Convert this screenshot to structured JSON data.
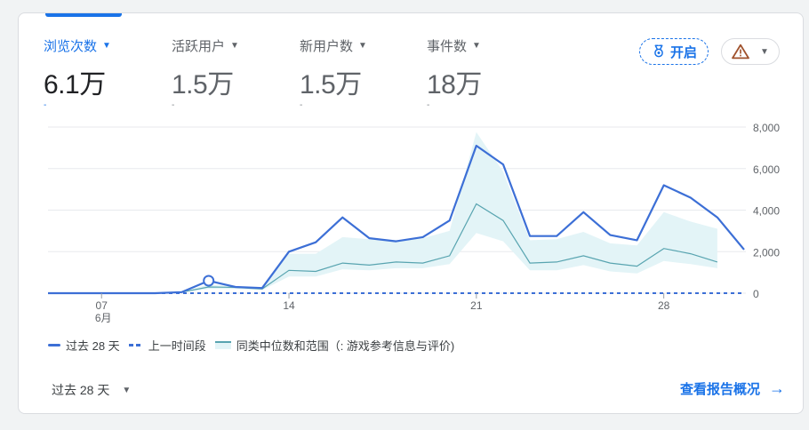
{
  "metrics": [
    {
      "label": "浏览次数",
      "value": "6.1万",
      "change": "-",
      "active": true
    },
    {
      "label": "活跃用户",
      "value": "1.5万",
      "change": "-",
      "active": false
    },
    {
      "label": "新用户数",
      "value": "1.5万",
      "change": "-",
      "active": false
    },
    {
      "label": "事件数",
      "value": "18万",
      "change": "-",
      "active": false
    }
  ],
  "buttons": {
    "open_label": "开启",
    "open_icon": "award-icon",
    "warning_icon": "warning-icon"
  },
  "legend": {
    "current": "过去 28 天",
    "previous": "上一时间段",
    "benchmark": "同类中位数和范围（: 游戏参考信息与评价)"
  },
  "footer": {
    "period_label": "过去 28 天",
    "report_link": "查看报告概况"
  },
  "colors": {
    "accent": "#1a73e8",
    "line": "#3c6fd6",
    "benchmark_line": "#58a4b0",
    "benchmark_band": "#e3f4f7"
  },
  "chart_data": {
    "type": "line",
    "x_days": [
      5,
      6,
      7,
      8,
      9,
      10,
      11,
      12,
      13,
      14,
      15,
      16,
      17,
      18,
      19,
      20,
      21,
      22,
      23,
      24,
      25,
      26,
      27,
      28,
      29,
      30,
      31
    ],
    "x_ticks": [
      {
        "day": 7,
        "label": "07",
        "sublabel": "6月"
      },
      {
        "day": 14,
        "label": "14"
      },
      {
        "day": 21,
        "label": "21"
      },
      {
        "day": 28,
        "label": "28"
      }
    ],
    "ylim": [
      0,
      8000
    ],
    "y_ticks": [
      0,
      2000,
      4000,
      6000,
      8000
    ],
    "y_tick_labels": [
      "0",
      "2,000",
      "4,000",
      "6,000",
      "8,000"
    ],
    "grid": true,
    "highlight_day": 11,
    "series": [
      {
        "values": [
          0,
          0,
          0,
          0,
          0,
          50,
          600,
          300,
          250,
          2000,
          2450,
          3650,
          2650,
          2500,
          2700,
          3500,
          7100,
          6200,
          2750,
          2750,
          3900,
          2800,
          2550,
          5200,
          4600,
          3650,
          2100
        ]
      },
      {
        "values": [
          0,
          0,
          0,
          0,
          0,
          0,
          0,
          0,
          0,
          0,
          0,
          0,
          0,
          0,
          0,
          0,
          0,
          0,
          0,
          0,
          0,
          0,
          0,
          0,
          0,
          0,
          0
        ],
        "style": "dashed"
      }
    ],
    "benchmark": {
      "start_day": 10,
      "median": [
        50,
        300,
        280,
        200,
        1100,
        1050,
        1450,
        1350,
        1500,
        1450,
        1800,
        4300,
        3500,
        1450,
        1500,
        1800,
        1450,
        1300,
        2150,
        1900,
        1500
      ],
      "upper": [
        80,
        420,
        330,
        250,
        1900,
        1900,
        2700,
        2600,
        2550,
        2650,
        3000,
        7750,
        5850,
        2550,
        2600,
        2950,
        2400,
        2300,
        3900,
        3450,
        3100
      ],
      "lower": [
        30,
        200,
        200,
        150,
        800,
        800,
        1150,
        1100,
        1200,
        1200,
        1400,
        2900,
        2500,
        1100,
        1100,
        1350,
        1050,
        950,
        1550,
        1400,
        1200
      ]
    }
  }
}
